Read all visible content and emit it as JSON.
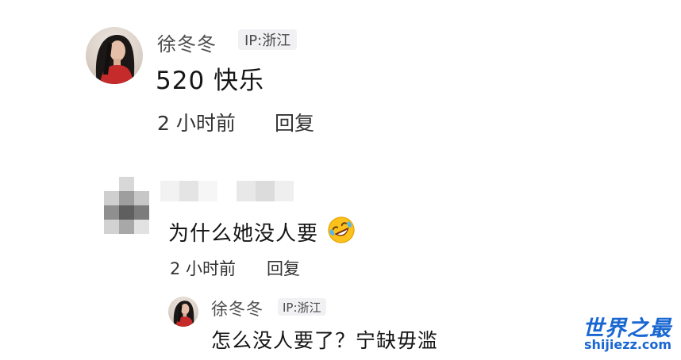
{
  "comments": [
    {
      "username": "徐冬冬",
      "ip": "IP:浙江",
      "text": "520 快乐",
      "time": "2 小时前",
      "reply_label": "回复",
      "avatar_icon": "user-avatar-woman-icon"
    },
    {
      "username": "",
      "ip": "",
      "text": "为什么她没人要",
      "emoji_icon": "rolling-laugh-emoji-icon",
      "time": "2 小时前",
      "reply_label": "回复",
      "avatar_icon": "blurred-avatar-icon"
    }
  ],
  "reply": {
    "username": "徐冬冬",
    "ip": "IP:浙江",
    "text": "怎么没人要了？宁缺毋滥",
    "avatar_icon": "user-avatar-woman-icon"
  },
  "watermark": {
    "title": "世界之最",
    "url": "shijiezz.com"
  },
  "colors": {
    "watermark": "#1967d2",
    "ip_badge_bg": "#f1f1f3",
    "text": "#151515"
  }
}
